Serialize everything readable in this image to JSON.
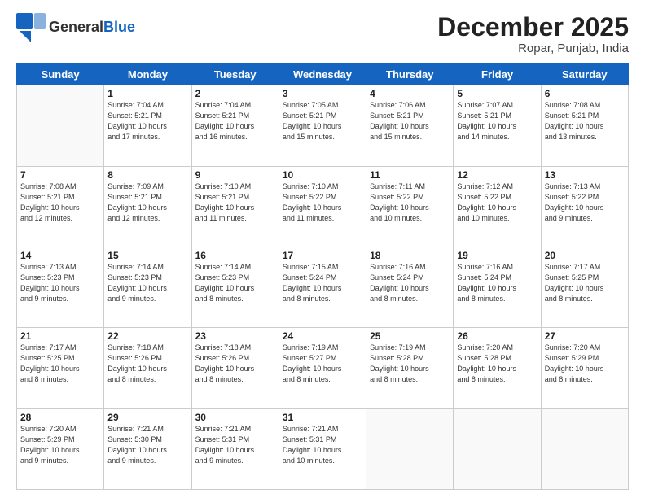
{
  "header": {
    "logo_general": "General",
    "logo_blue": "Blue",
    "title": "December 2025",
    "subtitle": "Ropar, Punjab, India"
  },
  "calendar": {
    "days_of_week": [
      "Sunday",
      "Monday",
      "Tuesday",
      "Wednesday",
      "Thursday",
      "Friday",
      "Saturday"
    ],
    "weeks": [
      [
        {
          "day": "",
          "info": ""
        },
        {
          "day": "1",
          "info": "Sunrise: 7:04 AM\nSunset: 5:21 PM\nDaylight: 10 hours\nand 17 minutes."
        },
        {
          "day": "2",
          "info": "Sunrise: 7:04 AM\nSunset: 5:21 PM\nDaylight: 10 hours\nand 16 minutes."
        },
        {
          "day": "3",
          "info": "Sunrise: 7:05 AM\nSunset: 5:21 PM\nDaylight: 10 hours\nand 15 minutes."
        },
        {
          "day": "4",
          "info": "Sunrise: 7:06 AM\nSunset: 5:21 PM\nDaylight: 10 hours\nand 15 minutes."
        },
        {
          "day": "5",
          "info": "Sunrise: 7:07 AM\nSunset: 5:21 PM\nDaylight: 10 hours\nand 14 minutes."
        },
        {
          "day": "6",
          "info": "Sunrise: 7:08 AM\nSunset: 5:21 PM\nDaylight: 10 hours\nand 13 minutes."
        }
      ],
      [
        {
          "day": "7",
          "info": "Sunrise: 7:08 AM\nSunset: 5:21 PM\nDaylight: 10 hours\nand 12 minutes."
        },
        {
          "day": "8",
          "info": "Sunrise: 7:09 AM\nSunset: 5:21 PM\nDaylight: 10 hours\nand 12 minutes."
        },
        {
          "day": "9",
          "info": "Sunrise: 7:10 AM\nSunset: 5:21 PM\nDaylight: 10 hours\nand 11 minutes."
        },
        {
          "day": "10",
          "info": "Sunrise: 7:10 AM\nSunset: 5:22 PM\nDaylight: 10 hours\nand 11 minutes."
        },
        {
          "day": "11",
          "info": "Sunrise: 7:11 AM\nSunset: 5:22 PM\nDaylight: 10 hours\nand 10 minutes."
        },
        {
          "day": "12",
          "info": "Sunrise: 7:12 AM\nSunset: 5:22 PM\nDaylight: 10 hours\nand 10 minutes."
        },
        {
          "day": "13",
          "info": "Sunrise: 7:13 AM\nSunset: 5:22 PM\nDaylight: 10 hours\nand 9 minutes."
        }
      ],
      [
        {
          "day": "14",
          "info": "Sunrise: 7:13 AM\nSunset: 5:23 PM\nDaylight: 10 hours\nand 9 minutes."
        },
        {
          "day": "15",
          "info": "Sunrise: 7:14 AM\nSunset: 5:23 PM\nDaylight: 10 hours\nand 9 minutes."
        },
        {
          "day": "16",
          "info": "Sunrise: 7:14 AM\nSunset: 5:23 PM\nDaylight: 10 hours\nand 8 minutes."
        },
        {
          "day": "17",
          "info": "Sunrise: 7:15 AM\nSunset: 5:24 PM\nDaylight: 10 hours\nand 8 minutes."
        },
        {
          "day": "18",
          "info": "Sunrise: 7:16 AM\nSunset: 5:24 PM\nDaylight: 10 hours\nand 8 minutes."
        },
        {
          "day": "19",
          "info": "Sunrise: 7:16 AM\nSunset: 5:24 PM\nDaylight: 10 hours\nand 8 minutes."
        },
        {
          "day": "20",
          "info": "Sunrise: 7:17 AM\nSunset: 5:25 PM\nDaylight: 10 hours\nand 8 minutes."
        }
      ],
      [
        {
          "day": "21",
          "info": "Sunrise: 7:17 AM\nSunset: 5:25 PM\nDaylight: 10 hours\nand 8 minutes."
        },
        {
          "day": "22",
          "info": "Sunrise: 7:18 AM\nSunset: 5:26 PM\nDaylight: 10 hours\nand 8 minutes."
        },
        {
          "day": "23",
          "info": "Sunrise: 7:18 AM\nSunset: 5:26 PM\nDaylight: 10 hours\nand 8 minutes."
        },
        {
          "day": "24",
          "info": "Sunrise: 7:19 AM\nSunset: 5:27 PM\nDaylight: 10 hours\nand 8 minutes."
        },
        {
          "day": "25",
          "info": "Sunrise: 7:19 AM\nSunset: 5:28 PM\nDaylight: 10 hours\nand 8 minutes."
        },
        {
          "day": "26",
          "info": "Sunrise: 7:20 AM\nSunset: 5:28 PM\nDaylight: 10 hours\nand 8 minutes."
        },
        {
          "day": "27",
          "info": "Sunrise: 7:20 AM\nSunset: 5:29 PM\nDaylight: 10 hours\nand 8 minutes."
        }
      ],
      [
        {
          "day": "28",
          "info": "Sunrise: 7:20 AM\nSunset: 5:29 PM\nDaylight: 10 hours\nand 9 minutes."
        },
        {
          "day": "29",
          "info": "Sunrise: 7:21 AM\nSunset: 5:30 PM\nDaylight: 10 hours\nand 9 minutes."
        },
        {
          "day": "30",
          "info": "Sunrise: 7:21 AM\nSunset: 5:31 PM\nDaylight: 10 hours\nand 9 minutes."
        },
        {
          "day": "31",
          "info": "Sunrise: 7:21 AM\nSunset: 5:31 PM\nDaylight: 10 hours\nand 10 minutes."
        },
        {
          "day": "",
          "info": ""
        },
        {
          "day": "",
          "info": ""
        },
        {
          "day": "",
          "info": ""
        }
      ]
    ]
  }
}
